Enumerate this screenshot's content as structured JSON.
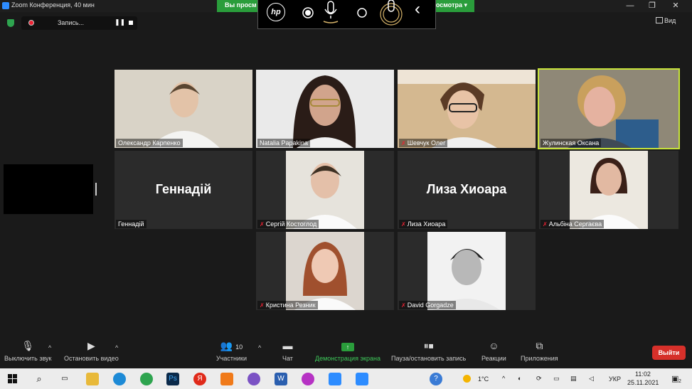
{
  "window": {
    "title": "Zoom Конференция, 40 мин",
    "minimize": "—",
    "restore": "❐",
    "close": "✕"
  },
  "share_banner": {
    "left_text": "Вы просм",
    "right_text": "росмотра ▾"
  },
  "hp_bar": {
    "logo": "hp",
    "chevron": "‹"
  },
  "recording": {
    "label": "Запись..."
  },
  "view_button": {
    "label": "Вид"
  },
  "participants": [
    {
      "name": "Олександр Карпенко",
      "muted": false
    },
    {
      "name": "Natalia Papakina",
      "muted": false
    },
    {
      "name": "Шевчук Олег",
      "muted": true
    },
    {
      "name": "Жулинская Оксана",
      "muted": false,
      "active_speaker": true
    },
    {
      "name": "Геннадій",
      "display_text": "Геннадій",
      "muted": false,
      "video_off": true
    },
    {
      "name": "Сергій Костоглод",
      "muted": true
    },
    {
      "name": "Лиза Хиоара",
      "display_text": "Лиза Хиоара",
      "muted": true,
      "video_off": true
    },
    {
      "name": "Альбіна Сергаєва",
      "muted": true
    },
    {
      "name": "Кристина Резник",
      "muted": true
    },
    {
      "name": "David Gorgadze",
      "muted": true
    }
  ],
  "toolbar": {
    "mute": "Выключить звук",
    "stop_video": "Остановить видео",
    "participants_label": "Участники",
    "participants_count": "10",
    "chat": "Чат",
    "share": "Демонстрация экрана",
    "record": "Пауза/остановить запись",
    "reactions": "Реакции",
    "apps": "Приложения",
    "leave": "Выйти"
  },
  "taskbar": {
    "weather": "1°C",
    "lang": "УКР",
    "time": "11:02",
    "date": "25.11.2021",
    "notifications": "2"
  },
  "colors": {
    "active_border": "#c8e43a",
    "share_green": "#2a9d3b",
    "leave_red": "#d6302a"
  }
}
